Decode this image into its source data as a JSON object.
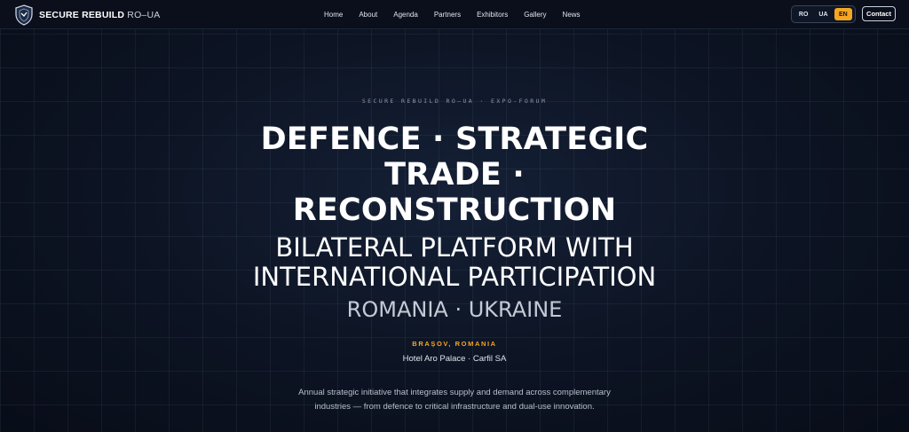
{
  "header": {
    "brand_name": "SECURE REBUILD",
    "brand_suffix": "RO–UA",
    "nav": [
      "Home",
      "About",
      "Agenda",
      "Partners",
      "Exhibitors",
      "Gallery",
      "News"
    ],
    "languages": [
      {
        "code": "RO",
        "active": false
      },
      {
        "code": "UA",
        "active": false
      },
      {
        "code": "EN",
        "active": true
      }
    ],
    "contact_label": "Contact"
  },
  "hero": {
    "eyebrow": "SECURE REBUILD RO–UA · EXPO-FORUM",
    "title": "DEFENCE · STRATEGIC TRADE · RECONSTRUCTION",
    "subtitle": "BILATERAL PLATFORM WITH INTERNATIONAL PARTICIPATION",
    "countries": "ROMANIA · UKRAINE",
    "location": "BRAȘOV, ROMANIA",
    "venue": "Hotel Aro Palace · Carfil SA",
    "description": "Annual strategic initiative that integrates supply and demand across complementary industries — from defence to critical infrastructure and dual-use innovation."
  },
  "colors": {
    "accent": "#f5a623",
    "background": "#0b1220"
  }
}
